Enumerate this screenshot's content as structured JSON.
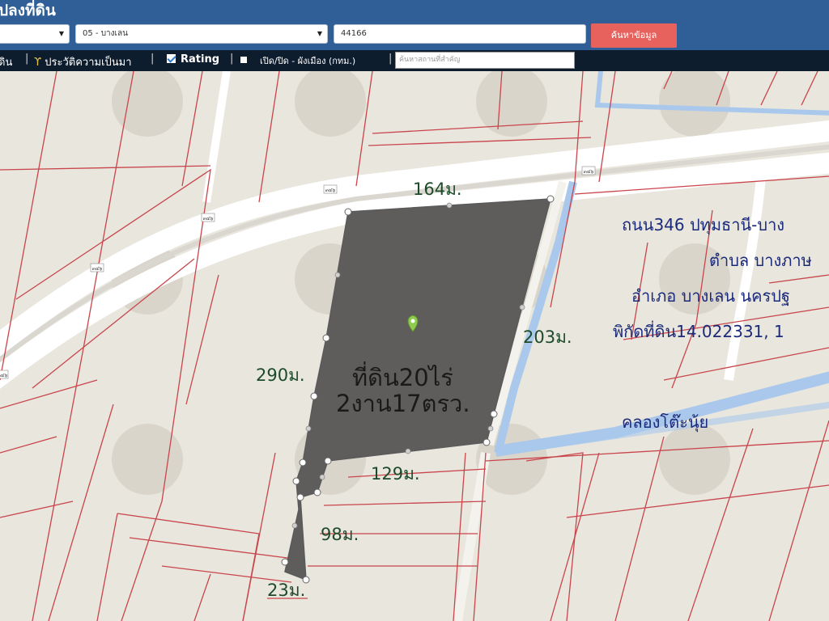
{
  "header": {
    "title": "ปลงที่ดิน",
    "district_select": "05 - บางเลน",
    "parcel_no": "44166",
    "search_button": "ค้นหาข้อมูล"
  },
  "toolbar": {
    "item_land": "ดิน",
    "item_history": "ประวัติความเป็นมา",
    "item_rating": "Rating",
    "item_cityplan": "เปิด/ปิด - ผังเมือง (กทม.)",
    "place_search_placeholder": "ค้นหาสถานที่สำคัญ",
    "separator": "|"
  },
  "map": {
    "road_shield": "๓๔๖",
    "dimensions": {
      "top": "164ม.",
      "left": "290ม.",
      "right": "203ม.",
      "bottom": "129ม.",
      "strip": "98ม.",
      "tip": "23ม."
    },
    "area_line1": "ที่ดิน20ไร่",
    "area_line2": "2งาน17ตรว.",
    "info": {
      "road": "ถนน346 ปทุมธานี-บาง",
      "tambon": "ตำบล บางภาษ",
      "amphoe": "อำเภอ บางเลน นครปฐ",
      "coords": "พิกัดที่ดิน14.022331, 1"
    },
    "canal": "คลองโต๊ะนุ้ย",
    "colors": {
      "parcel_fill": "#5f5c5c",
      "boundary": "#c9454b",
      "canal": "#a9c8ec",
      "header": "#2f5f96",
      "toolbar": "#0e1d2e",
      "button": "#e8625d",
      "label_text": "#1c2a7a",
      "dimension_text": "#1d4a2a"
    }
  }
}
